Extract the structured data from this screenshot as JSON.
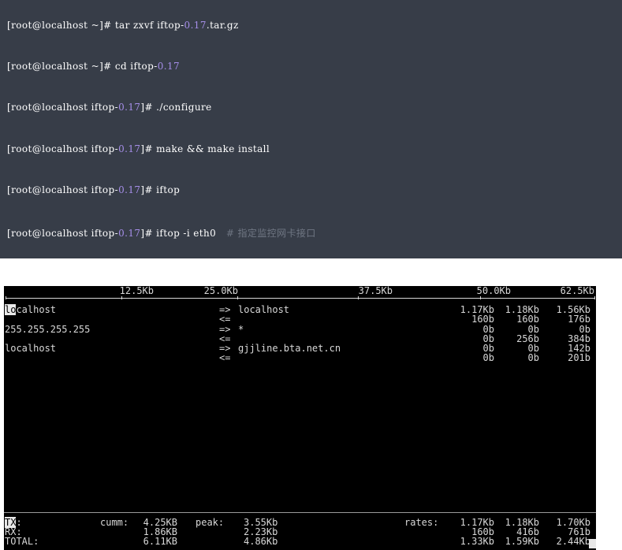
{
  "code": {
    "lines": [
      {
        "prefix": "[root@localhost ~]# tar zxvf iftop-",
        "num": "0.17",
        "suffix": ".tar.gz",
        "comment": ""
      },
      {
        "prefix": "[root@localhost ~]# cd iftop-",
        "num": "0.17",
        "suffix": "",
        "comment": ""
      },
      {
        "prefix": "[root@localhost iftop-",
        "num": "0.17",
        "suffix": "]# ./configure",
        "comment": ""
      },
      {
        "prefix": "[root@localhost iftop-",
        "num": "0.17",
        "suffix": "]# make && make install",
        "comment": ""
      },
      {
        "prefix": "[root@localhost iftop-",
        "num": "0.17",
        "suffix": "]# iftop",
        "comment": ""
      },
      {
        "prefix": "[root@localhost iftop-",
        "num": "0.17",
        "suffix": "]# iftop -i eth0",
        "comment": "# 指定监控网卡接口"
      }
    ]
  },
  "iftop": {
    "scale": [
      "12.5Kb",
      "25.0Kb",
      "37.5Kb",
      "50.0Kb",
      "62.5Kb"
    ],
    "hosts": [
      {
        "src_hl": "lo",
        "src": "calhost",
        "dirs": [
          "=>",
          "<="
        ],
        "dst": "localhost",
        "rates": [
          [
            "1.17Kb",
            "1.18Kb",
            "1.56Kb"
          ],
          [
            "160b",
            "160b",
            "176b"
          ]
        ]
      },
      {
        "src_hl": "",
        "src": "255.255.255.255",
        "dirs": [
          "=>",
          "<="
        ],
        "dst": "*",
        "rates": [
          [
            "0b",
            "0b",
            "0b"
          ],
          [
            "0b",
            "256b",
            "384b"
          ]
        ]
      },
      {
        "src_hl": "",
        "src": "localhost",
        "dirs": [
          "=>",
          "<="
        ],
        "dst": "gjjline.bta.net.cn",
        "rates": [
          [
            "0b",
            "0b",
            "142b"
          ],
          [
            "0b",
            "0b",
            "201b"
          ]
        ]
      }
    ],
    "footer": {
      "labels": [
        {
          "hl": "TX",
          "rest": ":"
        },
        {
          "hl": "",
          "rest": "RX:"
        },
        {
          "hl": "",
          "rest": "TOTAL:"
        }
      ],
      "cumm_label": "cumm:",
      "cumm": [
        "4.25KB",
        "1.86KB",
        "6.11KB"
      ],
      "peak_label": "peak:",
      "peak": [
        "3.55Kb",
        "2.23Kb",
        "4.86Kb"
      ],
      "rates_label": "rates:",
      "rates": [
        [
          "1.17Kb",
          "1.18Kb",
          "1.70Kb"
        ],
        [
          "160b",
          "416b",
          "761b"
        ],
        [
          "1.33Kb",
          "1.59Kb",
          "2.44Kb"
        ]
      ]
    }
  }
}
